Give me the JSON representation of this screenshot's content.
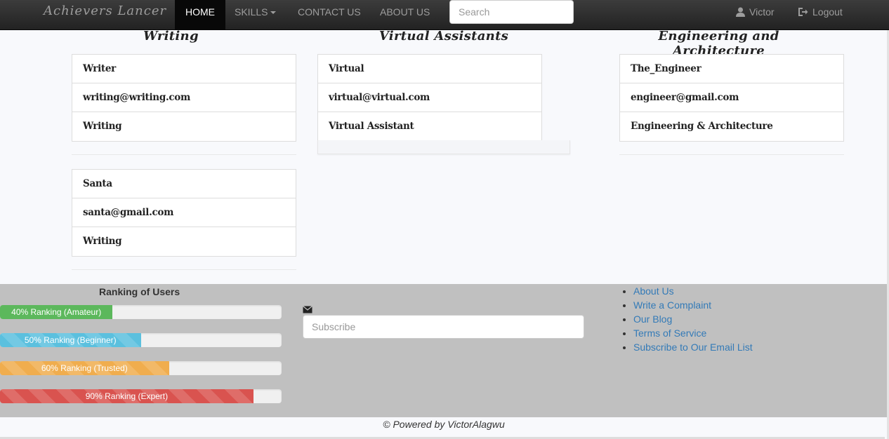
{
  "navbar": {
    "brand": "Achievers Lancer",
    "home": "HOME",
    "skills": "SKILLS",
    "contact": "CONTACT US",
    "about": "ABOUT US",
    "search_placeholder": "Search",
    "user": "Victor",
    "logout": "Logout"
  },
  "categories": [
    {
      "title": "Writing",
      "cards": [
        {
          "name": "Writer",
          "email": "writing@writing.com",
          "skill": "Writing"
        },
        {
          "name": "Santa",
          "email": "santa@gmail.com",
          "skill": "Writing"
        }
      ]
    },
    {
      "title": "Virtual Assistants",
      "cards": [
        {
          "name": "Virtual",
          "email": "virtual@virtual.com",
          "skill": "Virtual Assistant"
        }
      ]
    },
    {
      "title": "Engineering and Architecture",
      "cards": [
        {
          "name": "The_Engineer",
          "email": "engineer@gmail.com",
          "skill": "Engineering & Architecture"
        }
      ]
    }
  ],
  "footer": {
    "ranking_title": "Ranking of Users",
    "rankings": [
      {
        "label": "40% Ranking (Amateur)",
        "percent": 40,
        "color": "#5cb85c"
      },
      {
        "label": "50% Ranking (Beginner)",
        "percent": 50,
        "color": "#5bc0de"
      },
      {
        "label": "60% Ranking (Trusted)",
        "percent": 60,
        "color": "#f0ad4e"
      },
      {
        "label": "90% Ranking (Expert)",
        "percent": 90,
        "color": "#d9534f"
      }
    ],
    "subscribe_placeholder": "Subscribe",
    "links": [
      "About Us",
      "Write a Complaint",
      "Our Blog",
      "Terms of Service",
      "Subscribe to Our Email List"
    ],
    "powered_by": "© Powered by VictorAlagwu"
  }
}
